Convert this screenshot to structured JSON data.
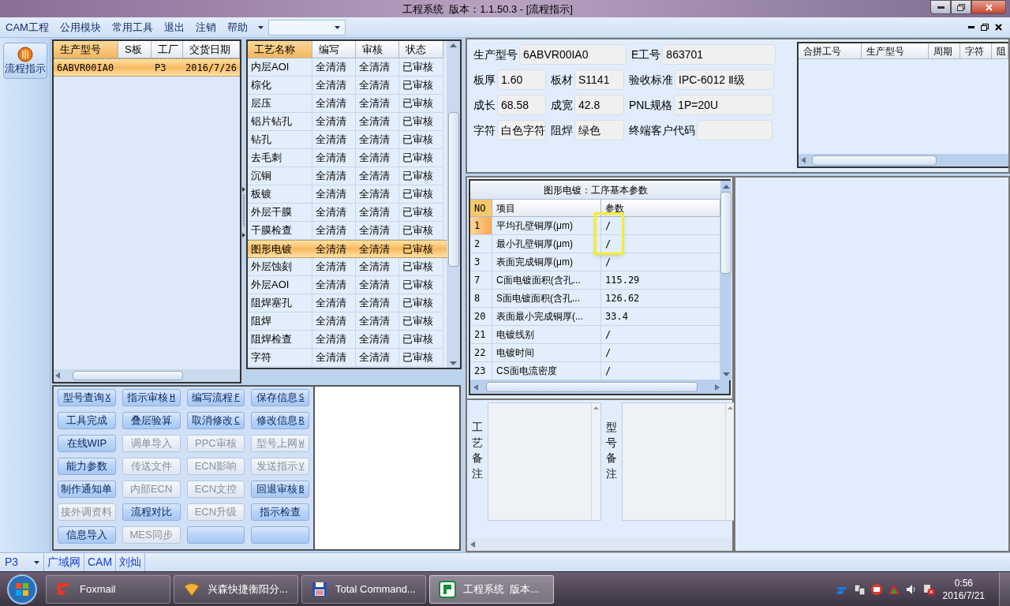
{
  "window": {
    "title": "工程系统  版本：1.1.50.3 - [流程指示]"
  },
  "menu": [
    "CAM工程",
    "公用模块",
    "常用工具",
    "退出",
    "注销",
    "帮助"
  ],
  "sidebar": {
    "items": [
      {
        "label": "流程指示",
        "selected": true
      }
    ]
  },
  "orders": {
    "columns": [
      {
        "label": "生产型号",
        "sorted": true
      },
      {
        "label": "S板",
        "sorted": false
      },
      {
        "label": "工厂",
        "sorted": false
      },
      {
        "label": "交货日期",
        "sorted": false
      }
    ],
    "rows": [
      {
        "model": "6ABVR00IA0",
        "factory": "P3",
        "date": "2016/7/26",
        "selected": true
      }
    ]
  },
  "processes": {
    "columns": [
      {
        "label": "工艺名称",
        "sorted": true
      },
      {
        "label": "编写",
        "sorted": false
      },
      {
        "label": "审核",
        "sorted": false
      },
      {
        "label": "状态",
        "sorted": false
      }
    ],
    "rows": [
      {
        "name": "内层AOI",
        "writer": "全清清",
        "reviewer": "全清清",
        "status": "已审核",
        "selected": false
      },
      {
        "name": "棕化",
        "writer": "全清清",
        "reviewer": "全清清",
        "status": "已审核",
        "selected": false
      },
      {
        "name": "层压",
        "writer": "全清清",
        "reviewer": "全清清",
        "status": "已审核",
        "selected": false
      },
      {
        "name": "铝片钻孔",
        "writer": "全清清",
        "reviewer": "全清清",
        "status": "已审核",
        "selected": false
      },
      {
        "name": "钻孔",
        "writer": "全清清",
        "reviewer": "全清清",
        "status": "已审核",
        "selected": false
      },
      {
        "name": "去毛刺",
        "writer": "全清清",
        "reviewer": "全清清",
        "status": "已审核",
        "selected": false
      },
      {
        "name": "沉铜",
        "writer": "全清清",
        "reviewer": "全清清",
        "status": "已审核",
        "selected": false
      },
      {
        "name": "板镀",
        "writer": "全清清",
        "reviewer": "全清清",
        "status": "已审核",
        "selected": false
      },
      {
        "name": "外层干膜",
        "writer": "全清清",
        "reviewer": "全清清",
        "status": "已审核",
        "selected": false
      },
      {
        "name": "干膜检查",
        "writer": "全清清",
        "reviewer": "全清清",
        "status": "已审核",
        "selected": false
      },
      {
        "name": "图形电镀",
        "writer": "全清清",
        "reviewer": "全清清",
        "status": "已审核",
        "selected": true
      },
      {
        "name": "外层蚀刻",
        "writer": "全清清",
        "reviewer": "全清清",
        "status": "已审核",
        "selected": false
      },
      {
        "name": "外层AOI",
        "writer": "全清清",
        "reviewer": "全清清",
        "status": "已审核",
        "selected": false
      },
      {
        "name": "阻焊塞孔",
        "writer": "全清清",
        "reviewer": "全清清",
        "status": "已审核",
        "selected": false
      },
      {
        "name": "阻焊",
        "writer": "全清清",
        "reviewer": "全清清",
        "status": "已审核",
        "selected": false
      },
      {
        "name": "阻焊检查",
        "writer": "全清清",
        "reviewer": "全清清",
        "status": "已审核",
        "selected": false
      },
      {
        "name": "字符",
        "writer": "全清清",
        "reviewer": "全清清",
        "status": "已审核",
        "selected": false
      }
    ]
  },
  "buttons": [
    {
      "label": "型号查询",
      "shortcut": "X",
      "disabled": false
    },
    {
      "label": "指示审核",
      "shortcut": "H",
      "disabled": false
    },
    {
      "label": "编写流程",
      "shortcut": "F",
      "disabled": false
    },
    {
      "label": "保存信息",
      "shortcut": "S",
      "disabled": false
    },
    {
      "label": "工具完成",
      "disabled": false
    },
    {
      "label": "叠层验算",
      "disabled": false
    },
    {
      "label": "取消修改",
      "shortcut": "C",
      "disabled": false
    },
    {
      "label": "修改信息",
      "shortcut": "R",
      "disabled": false
    },
    {
      "label": "在线WIP",
      "disabled": false
    },
    {
      "label": "调单导入",
      "disabled": true
    },
    {
      "label": "PPC审核",
      "disabled": true
    },
    {
      "label": "型号上网",
      "shortcut": "W",
      "disabled": true
    },
    {
      "label": "能力参数",
      "disabled": false
    },
    {
      "label": "传送文件",
      "disabled": true
    },
    {
      "label": "ECN影响",
      "disabled": true
    },
    {
      "label": "发送指示",
      "shortcut": "V",
      "disabled": true
    },
    {
      "label": "制作通知单",
      "disabled": false
    },
    {
      "label": "内部ECN",
      "disabled": true
    },
    {
      "label": "ECN文控",
      "disabled": true
    },
    {
      "label": "回退审核",
      "shortcut": "B",
      "disabled": false
    },
    {
      "label": "接外调资料",
      "disabled": true
    },
    {
      "label": "流程对比",
      "disabled": false
    },
    {
      "label": "ECN升级",
      "disabled": true
    },
    {
      "label": "指示检查",
      "disabled": false
    },
    {
      "label": "信息导入",
      "disabled": false
    },
    {
      "label": "MES同步",
      "disabled": true
    },
    {
      "disabled": false
    },
    {
      "disabled": false
    }
  ],
  "job": {
    "fields": [
      [
        {
          "label": "生产型号",
          "value": "6ABVR00IA0"
        },
        {
          "label": "E工号",
          "value": "863701"
        }
      ],
      [
        {
          "label": "板厚",
          "value": "1.60"
        },
        {
          "label": "板材",
          "value": "S1141"
        },
        {
          "label": "验收标准",
          "value": "IPC-6012 Ⅱ级"
        }
      ],
      [
        {
          "label": "成长",
          "value": "68.58"
        },
        {
          "label": "成宽",
          "value": "42.8"
        },
        {
          "label": "PNL规格",
          "value": "1P=20U"
        }
      ],
      [
        {
          "label": "字符",
          "value": "白色字符"
        },
        {
          "label": "阻焊",
          "value": "绿色"
        },
        {
          "label": "终端客户代码"
        }
      ]
    ]
  },
  "merge_grid": {
    "columns": [
      "合拼工号",
      "生产型号",
      "周期",
      "字符",
      "阻"
    ]
  },
  "params": {
    "title": "图形电镀：工序基本参数",
    "columns": [
      "NO",
      "项目",
      "参数"
    ],
    "rows": [
      {
        "no": "1",
        "item": "平均孔壁铜厚(μm)",
        "value": "/",
        "selected": true,
        "highlighted": true
      },
      {
        "no": "2",
        "item": "最小孔壁铜厚(μm)",
        "value": "/",
        "selected": false,
        "highlighted": true
      },
      {
        "no": "3",
        "item": "表面完成铜厚(μm)",
        "value": "/",
        "selected": false,
        "highlighted": false
      },
      {
        "no": "7",
        "item": "C面电镀面积(含孔...",
        "value": "115.29",
        "selected": false,
        "highlighted": false
      },
      {
        "no": "8",
        "item": "S面电镀面积(含孔...",
        "value": "126.62",
        "selected": false,
        "highlighted": false
      },
      {
        "no": "20",
        "item": "表面最小完成铜厚(...",
        "value": "33.4",
        "selected": false,
        "highlighted": false
      },
      {
        "no": "21",
        "item": "电镀线别",
        "value": "/",
        "selected": false,
        "highlighted": false
      },
      {
        "no": "22",
        "item": "电镀时间",
        "value": "/",
        "selected": false,
        "highlighted": false
      },
      {
        "no": "23",
        "item": "CS面电流密度",
        "value": "/",
        "selected": false,
        "highlighted": false
      }
    ]
  },
  "notes": [
    {
      "label": "工艺备注"
    },
    {
      "label": "型号备注"
    }
  ],
  "status_bar": {
    "factory": "P3",
    "items": [
      "广域网",
      "CAM",
      "刘灿"
    ]
  },
  "taskbar": {
    "tasks": [
      {
        "label": "Foxmail",
        "selected": false
      },
      {
        "label": "兴森快捷衡阳分...",
        "selected": false
      },
      {
        "label": "Total Command...",
        "selected": false
      },
      {
        "label": "工程系统  版本...",
        "selected": true
      }
    ],
    "clock": {
      "time": "0:56",
      "date": "2016/7/21"
    }
  }
}
